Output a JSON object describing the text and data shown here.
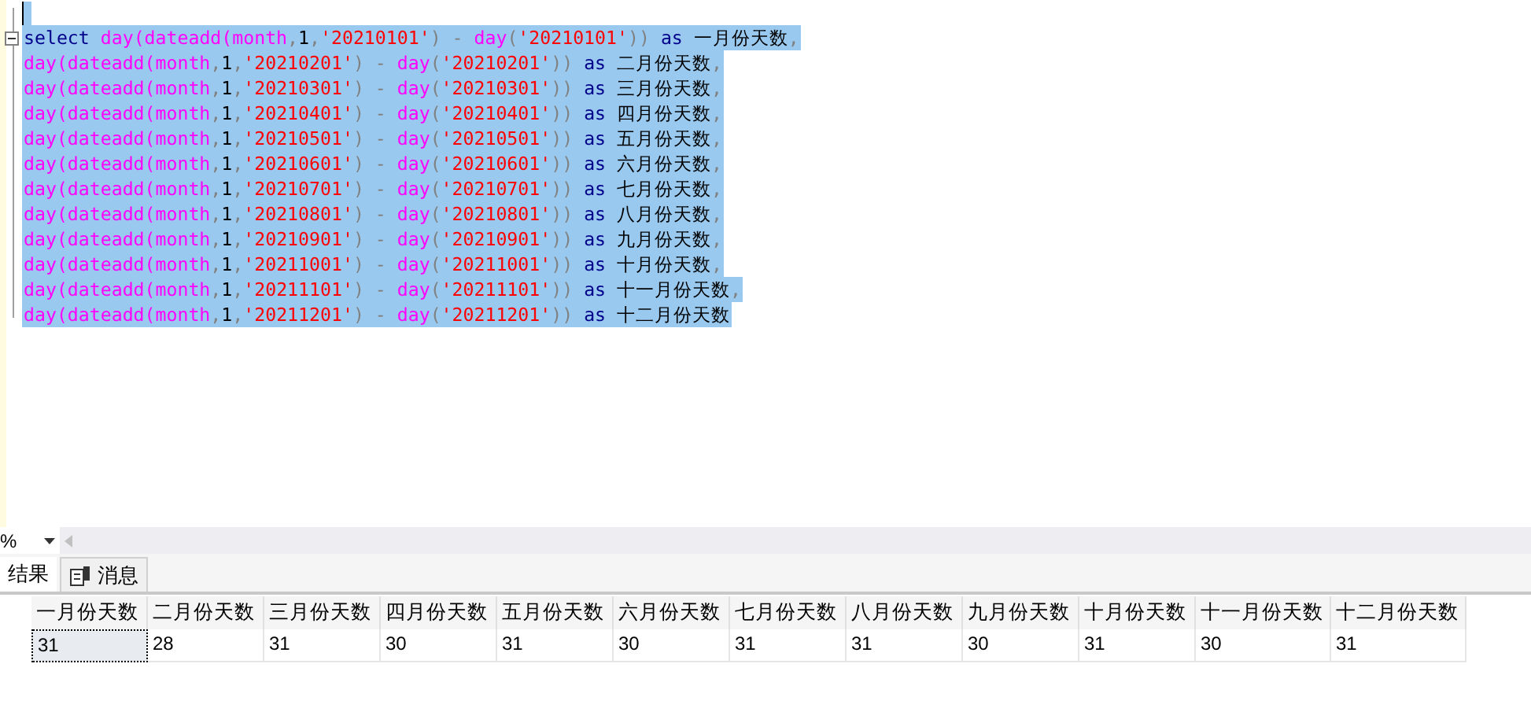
{
  "editor": {
    "lines": [
      {
        "selected": true
      },
      {
        "selected": true,
        "tokens": [
          {
            "kind": "keyword",
            "text": "select "
          },
          {
            "kind": "function",
            "text": "day(dateadd(month"
          },
          {
            "kind": "operator",
            "text": ","
          },
          {
            "kind": "plain",
            "text": "1"
          },
          {
            "kind": "operator",
            "text": ","
          },
          {
            "kind": "string",
            "text": "'20210101'"
          },
          {
            "kind": "operator",
            "text": ") - "
          },
          {
            "kind": "function",
            "text": "day"
          },
          {
            "kind": "operator",
            "text": "("
          },
          {
            "kind": "string",
            "text": "'20210101'"
          },
          {
            "kind": "operator",
            "text": ")) "
          },
          {
            "kind": "keyword",
            "text": "as"
          },
          {
            "kind": "plain",
            "text": " 一月份天数"
          },
          {
            "kind": "operator",
            "text": ","
          }
        ]
      },
      {
        "selected": true,
        "tokens": [
          {
            "kind": "function",
            "text": "day(dateadd(month"
          },
          {
            "kind": "operator",
            "text": ","
          },
          {
            "kind": "plain",
            "text": "1"
          },
          {
            "kind": "operator",
            "text": ","
          },
          {
            "kind": "string",
            "text": "'20210201'"
          },
          {
            "kind": "operator",
            "text": ") - "
          },
          {
            "kind": "function",
            "text": "day"
          },
          {
            "kind": "operator",
            "text": "("
          },
          {
            "kind": "string",
            "text": "'20210201'"
          },
          {
            "kind": "operator",
            "text": ")) "
          },
          {
            "kind": "keyword",
            "text": "as"
          },
          {
            "kind": "plain",
            "text": " 二月份天数"
          },
          {
            "kind": "operator",
            "text": ","
          }
        ]
      },
      {
        "selected": true,
        "tokens": [
          {
            "kind": "function",
            "text": "day(dateadd(month"
          },
          {
            "kind": "operator",
            "text": ","
          },
          {
            "kind": "plain",
            "text": "1"
          },
          {
            "kind": "operator",
            "text": ","
          },
          {
            "kind": "string",
            "text": "'20210301'"
          },
          {
            "kind": "operator",
            "text": ") - "
          },
          {
            "kind": "function",
            "text": "day"
          },
          {
            "kind": "operator",
            "text": "("
          },
          {
            "kind": "string",
            "text": "'20210301'"
          },
          {
            "kind": "operator",
            "text": ")) "
          },
          {
            "kind": "keyword",
            "text": "as"
          },
          {
            "kind": "plain",
            "text": " 三月份天数"
          },
          {
            "kind": "operator",
            "text": ","
          }
        ]
      },
      {
        "selected": true,
        "tokens": [
          {
            "kind": "function",
            "text": "day(dateadd(month"
          },
          {
            "kind": "operator",
            "text": ","
          },
          {
            "kind": "plain",
            "text": "1"
          },
          {
            "kind": "operator",
            "text": ","
          },
          {
            "kind": "string",
            "text": "'20210401'"
          },
          {
            "kind": "operator",
            "text": ") - "
          },
          {
            "kind": "function",
            "text": "day"
          },
          {
            "kind": "operator",
            "text": "("
          },
          {
            "kind": "string",
            "text": "'20210401'"
          },
          {
            "kind": "operator",
            "text": ")) "
          },
          {
            "kind": "keyword",
            "text": "as"
          },
          {
            "kind": "plain",
            "text": " 四月份天数"
          },
          {
            "kind": "operator",
            "text": ","
          }
        ]
      },
      {
        "selected": true,
        "tokens": [
          {
            "kind": "function",
            "text": "day(dateadd(month"
          },
          {
            "kind": "operator",
            "text": ","
          },
          {
            "kind": "plain",
            "text": "1"
          },
          {
            "kind": "operator",
            "text": ","
          },
          {
            "kind": "string",
            "text": "'20210501'"
          },
          {
            "kind": "operator",
            "text": ") - "
          },
          {
            "kind": "function",
            "text": "day"
          },
          {
            "kind": "operator",
            "text": "("
          },
          {
            "kind": "string",
            "text": "'20210501'"
          },
          {
            "kind": "operator",
            "text": ")) "
          },
          {
            "kind": "keyword",
            "text": "as"
          },
          {
            "kind": "plain",
            "text": " 五月份天数"
          },
          {
            "kind": "operator",
            "text": ","
          }
        ]
      },
      {
        "selected": true,
        "tokens": [
          {
            "kind": "function",
            "text": "day(dateadd(month"
          },
          {
            "kind": "operator",
            "text": ","
          },
          {
            "kind": "plain",
            "text": "1"
          },
          {
            "kind": "operator",
            "text": ","
          },
          {
            "kind": "string",
            "text": "'20210601'"
          },
          {
            "kind": "operator",
            "text": ") - "
          },
          {
            "kind": "function",
            "text": "day"
          },
          {
            "kind": "operator",
            "text": "("
          },
          {
            "kind": "string",
            "text": "'20210601'"
          },
          {
            "kind": "operator",
            "text": ")) "
          },
          {
            "kind": "keyword",
            "text": "as"
          },
          {
            "kind": "plain",
            "text": " 六月份天数"
          },
          {
            "kind": "operator",
            "text": ","
          }
        ]
      },
      {
        "selected": true,
        "tokens": [
          {
            "kind": "function",
            "text": "day(dateadd(month"
          },
          {
            "kind": "operator",
            "text": ","
          },
          {
            "kind": "plain",
            "text": "1"
          },
          {
            "kind": "operator",
            "text": ","
          },
          {
            "kind": "string",
            "text": "'20210701'"
          },
          {
            "kind": "operator",
            "text": ") - "
          },
          {
            "kind": "function",
            "text": "day"
          },
          {
            "kind": "operator",
            "text": "("
          },
          {
            "kind": "string",
            "text": "'20210701'"
          },
          {
            "kind": "operator",
            "text": ")) "
          },
          {
            "kind": "keyword",
            "text": "as"
          },
          {
            "kind": "plain",
            "text": " 七月份天数"
          },
          {
            "kind": "operator",
            "text": ","
          }
        ]
      },
      {
        "selected": true,
        "tokens": [
          {
            "kind": "function",
            "text": "day(dateadd(month"
          },
          {
            "kind": "operator",
            "text": ","
          },
          {
            "kind": "plain",
            "text": "1"
          },
          {
            "kind": "operator",
            "text": ","
          },
          {
            "kind": "string",
            "text": "'20210801'"
          },
          {
            "kind": "operator",
            "text": ") - "
          },
          {
            "kind": "function",
            "text": "day"
          },
          {
            "kind": "operator",
            "text": "("
          },
          {
            "kind": "string",
            "text": "'20210801'"
          },
          {
            "kind": "operator",
            "text": ")) "
          },
          {
            "kind": "keyword",
            "text": "as"
          },
          {
            "kind": "plain",
            "text": " 八月份天数"
          },
          {
            "kind": "operator",
            "text": ","
          }
        ]
      },
      {
        "selected": true,
        "tokens": [
          {
            "kind": "function",
            "text": "day(dateadd(month"
          },
          {
            "kind": "operator",
            "text": ","
          },
          {
            "kind": "plain",
            "text": "1"
          },
          {
            "kind": "operator",
            "text": ","
          },
          {
            "kind": "string",
            "text": "'20210901'"
          },
          {
            "kind": "operator",
            "text": ") - "
          },
          {
            "kind": "function",
            "text": "day"
          },
          {
            "kind": "operator",
            "text": "("
          },
          {
            "kind": "string",
            "text": "'20210901'"
          },
          {
            "kind": "operator",
            "text": ")) "
          },
          {
            "kind": "keyword",
            "text": "as"
          },
          {
            "kind": "plain",
            "text": " 九月份天数"
          },
          {
            "kind": "operator",
            "text": ","
          }
        ]
      },
      {
        "selected": true,
        "tokens": [
          {
            "kind": "function",
            "text": "day(dateadd(month"
          },
          {
            "kind": "operator",
            "text": ","
          },
          {
            "kind": "plain",
            "text": "1"
          },
          {
            "kind": "operator",
            "text": ","
          },
          {
            "kind": "string",
            "text": "'20211001'"
          },
          {
            "kind": "operator",
            "text": ") - "
          },
          {
            "kind": "function",
            "text": "day"
          },
          {
            "kind": "operator",
            "text": "("
          },
          {
            "kind": "string",
            "text": "'20211001'"
          },
          {
            "kind": "operator",
            "text": ")) "
          },
          {
            "kind": "keyword",
            "text": "as"
          },
          {
            "kind": "plain",
            "text": " 十月份天数"
          },
          {
            "kind": "operator",
            "text": ","
          }
        ]
      },
      {
        "selected": true,
        "tokens": [
          {
            "kind": "function",
            "text": "day(dateadd(month"
          },
          {
            "kind": "operator",
            "text": ","
          },
          {
            "kind": "plain",
            "text": "1"
          },
          {
            "kind": "operator",
            "text": ","
          },
          {
            "kind": "string",
            "text": "'20211101'"
          },
          {
            "kind": "operator",
            "text": ") - "
          },
          {
            "kind": "function",
            "text": "day"
          },
          {
            "kind": "operator",
            "text": "("
          },
          {
            "kind": "string",
            "text": "'20211101'"
          },
          {
            "kind": "operator",
            "text": ")) "
          },
          {
            "kind": "keyword",
            "text": "as"
          },
          {
            "kind": "plain",
            "text": " 十一月份天数"
          },
          {
            "kind": "operator",
            "text": ","
          }
        ]
      },
      {
        "selected": true,
        "tokens": [
          {
            "kind": "function",
            "text": "day(dateadd(month"
          },
          {
            "kind": "operator",
            "text": ","
          },
          {
            "kind": "plain",
            "text": "1"
          },
          {
            "kind": "operator",
            "text": ","
          },
          {
            "kind": "string",
            "text": "'20211201'"
          },
          {
            "kind": "operator",
            "text": ") - "
          },
          {
            "kind": "function",
            "text": "day"
          },
          {
            "kind": "operator",
            "text": "("
          },
          {
            "kind": "string",
            "text": "'20211201'"
          },
          {
            "kind": "operator",
            "text": ")) "
          },
          {
            "kind": "keyword",
            "text": "as"
          },
          {
            "kind": "plain",
            "text": " 十二月份天数"
          }
        ]
      }
    ]
  },
  "zoom": {
    "value": "%"
  },
  "result_tabs": [
    {
      "label": "结果",
      "selected": true,
      "kind": "plain"
    },
    {
      "label": "消息",
      "selected": false,
      "kind": "icon"
    }
  ],
  "grid": {
    "columns": [
      "一月份天数",
      "二月份天数",
      "三月份天数",
      "四月份天数",
      "五月份天数",
      "六月份天数",
      "七月份天数",
      "八月份天数",
      "九月份天数",
      "十月份天数",
      "十一月份天数",
      "十二月份天数"
    ],
    "rows": [
      {
        "cells": [
          {
            "value": "31",
            "selected": true
          },
          {
            "value": "28",
            "selected": false
          },
          {
            "value": "31",
            "selected": false
          },
          {
            "value": "30",
            "selected": false
          },
          {
            "value": "31",
            "selected": false
          },
          {
            "value": "30",
            "selected": false
          },
          {
            "value": "31",
            "selected": false
          },
          {
            "value": "31",
            "selected": false
          },
          {
            "value": "30",
            "selected": false
          },
          {
            "value": "31",
            "selected": false
          },
          {
            "value": "30",
            "selected": false
          },
          {
            "value": "31",
            "selected": false
          }
        ]
      }
    ]
  }
}
